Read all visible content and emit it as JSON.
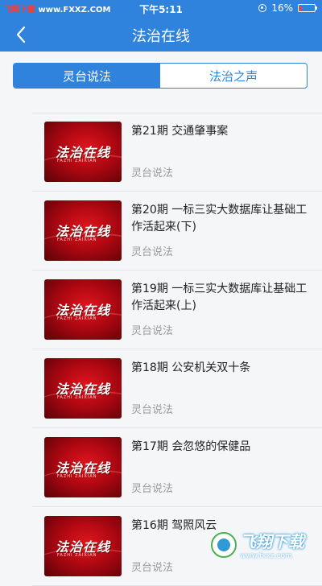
{
  "status_bar": {
    "watermark_prefix": "飞翔下载",
    "watermark_url": "www.FXXZ.COM",
    "time": "下午5:11",
    "battery": "16%",
    "battery_level": 0.16
  },
  "nav": {
    "title": "法治在线"
  },
  "tabs": [
    {
      "label": "灵台说法",
      "active": true
    },
    {
      "label": "法治之声",
      "active": false
    }
  ],
  "thumbnail": {
    "logo": "法治在线",
    "subtitle": "FAZHI ZAIXIAN"
  },
  "items": [
    {
      "title": "第21期  交通肇事案",
      "source": "灵台说法"
    },
    {
      "title": "第20期  一标三实大数据库让基础工作活起来(下)",
      "source": "灵台说法"
    },
    {
      "title": "第19期  一标三实大数据库让基础工作活起来(上)",
      "source": "灵台说法"
    },
    {
      "title": "第18期  公安机关双十条",
      "source": "灵台说法"
    },
    {
      "title": "第17期  会忽悠的保健品",
      "source": "灵台说法"
    },
    {
      "title": "第16期  驾照风云",
      "source": "灵台说法"
    }
  ],
  "watermark": {
    "name": "飞翔下载",
    "url": "www.fxxz.com"
  },
  "colors": {
    "primary": "#2f83dc",
    "battery": "#ff3b30"
  }
}
